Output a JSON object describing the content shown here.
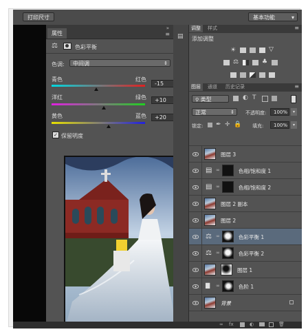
{
  "topbar": {
    "print_size": "打印尺寸",
    "workspace": "基本功能"
  },
  "properties": {
    "tab": "属性",
    "title": "色彩平衡",
    "tone_label": "色调:",
    "tone_value": "中间调",
    "sliders": [
      {
        "left": "青色",
        "right": "红色",
        "value": "-15",
        "level": 0.46
      },
      {
        "left": "洋红",
        "right": "绿色",
        "value": "+10",
        "level": 0.54
      },
      {
        "left": "黄色",
        "right": "蓝色",
        "value": "+20",
        "level": 0.58
      }
    ],
    "preserve_luminosity": "保留明度"
  },
  "adjustments": {
    "tab_active": "调整",
    "tab_other": "样式",
    "add_label": "添加调整"
  },
  "layers_panel": {
    "tabs": [
      "图层",
      "通道",
      "历史记录"
    ],
    "filter_value": "类型",
    "blend_mode": "正常",
    "opacity_label": "不透明度:",
    "opacity_value": "100%",
    "lock_label": "锁定:",
    "fill_label": "填充:",
    "fill_value": "100%",
    "layers": [
      {
        "name": "图层 3",
        "kind": "photo",
        "selected": false
      },
      {
        "name": "色相/饱和度 1",
        "kind": "adjust-hue",
        "selected": false
      },
      {
        "name": "色相/饱和度 2",
        "kind": "adjust-hue",
        "selected": false
      },
      {
        "name": "图层 2 副本",
        "kind": "photo",
        "selected": false
      },
      {
        "name": "图层 2",
        "kind": "photo",
        "selected": false
      },
      {
        "name": "色彩平衡 1",
        "kind": "adjust-balance",
        "selected": true
      },
      {
        "name": "色彩平衡 2",
        "kind": "adjust-balance",
        "selected": false
      },
      {
        "name": "图层 1",
        "kind": "photo-mask",
        "selected": false
      },
      {
        "name": "色阶 1",
        "kind": "adjust-levels",
        "selected": false
      },
      {
        "name": "背景",
        "kind": "background",
        "selected": false
      }
    ]
  },
  "colors": {
    "panel": "#535353",
    "selected_layer": "#5a6a7c",
    "canvas": "#080808"
  }
}
